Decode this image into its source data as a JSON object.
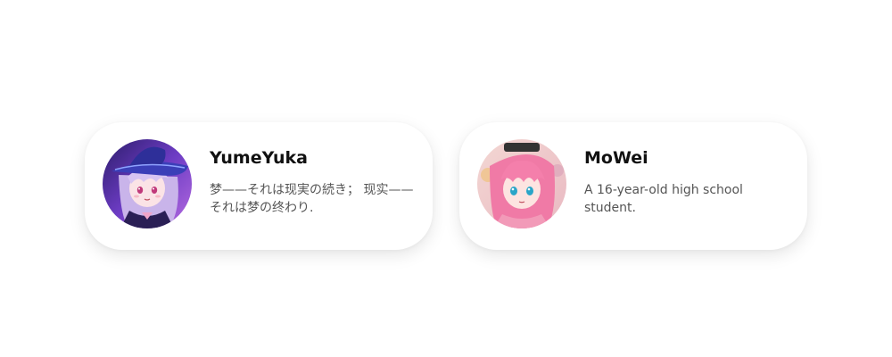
{
  "cards": [
    {
      "name": "YumeYuka",
      "bio": "梦——それは现実の続き； 现实——それは梦の终わり.",
      "avatar_icon": "anime-girl-witch-hat-avatar-icon"
    },
    {
      "name": "MoWei",
      "bio": "A 16-year-old high school student.",
      "avatar_icon": "anime-girl-pink-hair-avatar-icon"
    }
  ],
  "colors": {
    "card_bg": "#ffffff",
    "name": "#111111",
    "bio": "#555555"
  }
}
